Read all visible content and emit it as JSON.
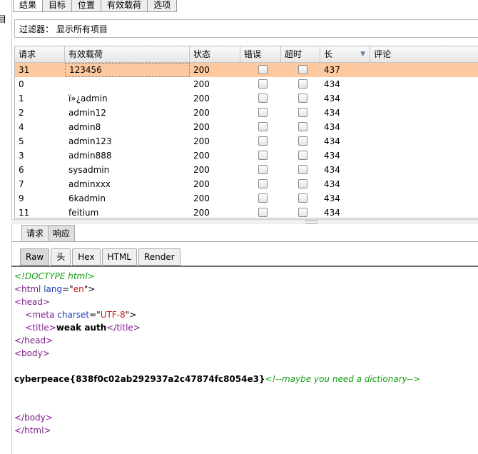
{
  "top_tabs": [
    "结果",
    "目标",
    "位置",
    "有效载荷",
    "选项"
  ],
  "left_fragment": "目",
  "filter": {
    "text": "过滤器： 显示所有项目"
  },
  "table": {
    "columns": [
      "请求",
      "有效载荷",
      "状态",
      "错误",
      "超时",
      "长",
      "评论"
    ],
    "rows": [
      {
        "req": "31",
        "payload": "123456",
        "status": "200",
        "len": "437",
        "selected": true
      },
      {
        "req": "0",
        "payload": "",
        "status": "200",
        "len": "434"
      },
      {
        "req": "1",
        "payload": "ï»¿admin",
        "status": "200",
        "len": "434"
      },
      {
        "req": "2",
        "payload": "admin12",
        "status": "200",
        "len": "434"
      },
      {
        "req": "4",
        "payload": "admin8",
        "status": "200",
        "len": "434"
      },
      {
        "req": "5",
        "payload": "admin123",
        "status": "200",
        "len": "434"
      },
      {
        "req": "3",
        "payload": "admin888",
        "status": "200",
        "len": "434"
      },
      {
        "req": "6",
        "payload": "sysadmin",
        "status": "200",
        "len": "434"
      },
      {
        "req": "7",
        "payload": "adminxxx",
        "status": "200",
        "len": "434"
      },
      {
        "req": "9",
        "payload": "6kadmin",
        "status": "200",
        "len": "434"
      },
      {
        "req": "11",
        "payload": "feitium",
        "status": "200",
        "len": "434"
      }
    ]
  },
  "sub_tabs": [
    "请求",
    "响应"
  ],
  "view_tabs": [
    "Raw",
    "头",
    "Hex",
    "HTML",
    "Render"
  ],
  "code": {
    "doctype": "<!DOCTYPE html>",
    "html_open_tag": "<html",
    "lang_attr": " lang",
    "lang_eq": "=\"",
    "lang_val": "en",
    "lang_close": "\">",
    "head_open": "<head>",
    "meta_open": "<meta",
    "charset_attr": " charset",
    "charset_eq": "=\"",
    "charset_val": "UTF-8",
    "charset_close": "\">",
    "title_open": "<title>",
    "title_text": "weak auth",
    "title_close": "</title>",
    "head_close": "</head>",
    "body_open": "<body>",
    "flag": "cyberpeace{838f0c02ab292937a2c47874fc8054e3}",
    "comment": "<!--maybe you need a dictionary-->",
    "body_close": "</body>",
    "html_close": "</html>"
  }
}
